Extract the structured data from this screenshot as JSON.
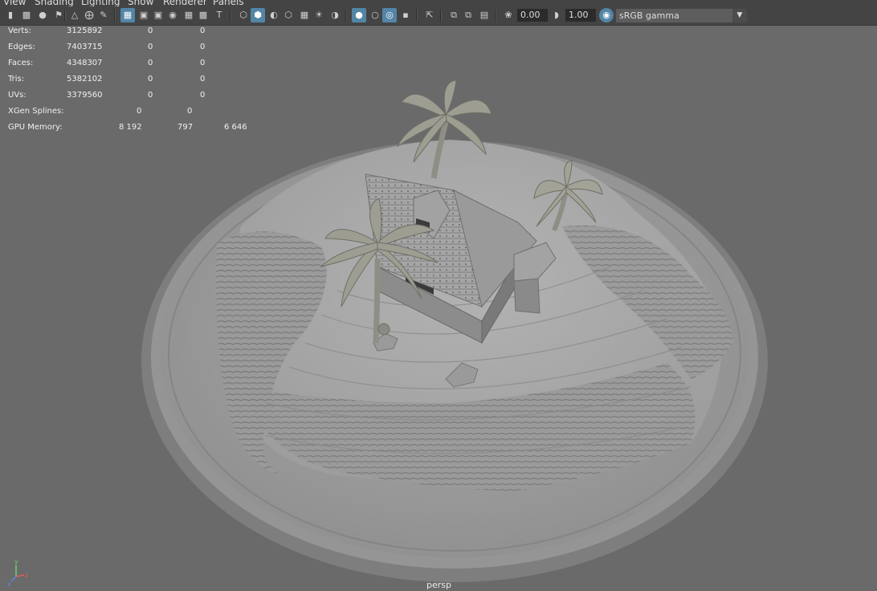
{
  "menu": [
    "View",
    "Shading",
    "Lighting",
    "Show",
    "Renderer",
    "Panels"
  ],
  "toolbar": {
    "exposure_value": "0.00",
    "gamma_value": "1.00",
    "color_space": "sRGB gamma"
  },
  "hud": {
    "rows": [
      {
        "label": "Verts:",
        "c1": "3125892",
        "c2": "0",
        "c3": "0"
      },
      {
        "label": "Edges:",
        "c1": "7403715",
        "c2": "0",
        "c3": "0"
      },
      {
        "label": "Faces:",
        "c1": "4348307",
        "c2": "0",
        "c3": "0"
      },
      {
        "label": "Tris:",
        "c1": "5382102",
        "c2": "0",
        "c3": "0"
      },
      {
        "label": "UVs:",
        "c1": "3379560",
        "c2": "0",
        "c3": "0"
      }
    ],
    "xgen": {
      "label": "XGen Splines:",
      "c1": "0",
      "c2": "0"
    },
    "gpu": {
      "label": "GPU Memory:",
      "c1": "8 192",
      "c2": "797",
      "c3": "6 646"
    }
  },
  "viewport": {
    "camera": "persp",
    "axis_labels": {
      "x": "x",
      "y": "y",
      "z": "z"
    }
  },
  "colors": {
    "toolbar_bg": "#444444",
    "accent": "#5285a6",
    "viewport_bg": "#6a6a6a"
  }
}
